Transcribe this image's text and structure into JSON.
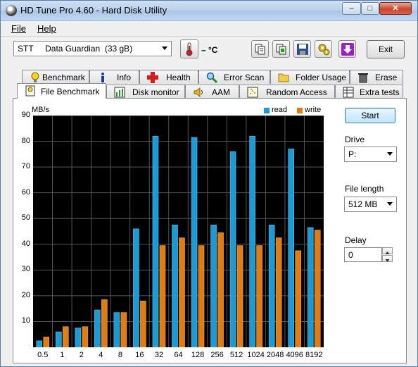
{
  "window": {
    "title": "HD Tune Pro 4.60 - Hard Disk Utility"
  },
  "menu": [
    "File",
    "Help"
  ],
  "toolbar": {
    "disk": "STT     Data Guardian  (33 gB)",
    "temperature": "– °C",
    "exit_label": "Exit"
  },
  "tabs_top": [
    "Benchmark",
    "Info",
    "Health",
    "Error Scan",
    "Folder Usage",
    "Erase"
  ],
  "tabs_bottom": [
    "File Benchmark",
    "Disk monitor",
    "AAM",
    "Random Access",
    "Extra tests"
  ],
  "side": {
    "start_label": "Start",
    "drive_label": "Drive",
    "drive_value": "P:",
    "file_length_label": "File length",
    "file_length_value": "512 MB",
    "delay_label": "Delay",
    "delay_value": "0"
  },
  "colors": {
    "read": "#1c9ad6",
    "write": "#e07c12",
    "plot_bg": "#000000",
    "grid": "#555555"
  },
  "chart_data": {
    "type": "bar",
    "ylabel": "MB/s",
    "ylim": [
      0,
      90
    ],
    "yticks": [
      10,
      20,
      30,
      40,
      50,
      60,
      70,
      80,
      90
    ],
    "categories": [
      "0.5",
      "1",
      "2",
      "4",
      "8",
      "16",
      "32",
      "64",
      "128",
      "256",
      "512",
      "1024",
      "2048",
      "4096",
      "8192"
    ],
    "series": [
      {
        "name": "read",
        "values": [
          2.5,
          6,
          7.5,
          14.5,
          13.5,
          46,
          82,
          47.5,
          81.5,
          47.5,
          76,
          82,
          47.5,
          77,
          46.5
        ]
      },
      {
        "name": "write",
        "values": [
          4,
          8,
          8,
          18.5,
          13.5,
          18,
          39.5,
          42.5,
          39.5,
          44.5,
          39.5,
          39.5,
          42.5,
          37.5,
          45.5
        ]
      }
    ],
    "grid": true,
    "legend": "top-right"
  }
}
